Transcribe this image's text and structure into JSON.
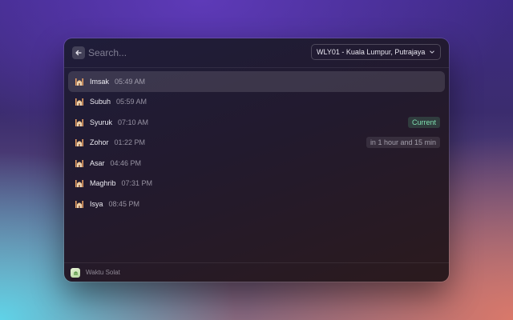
{
  "search": {
    "placeholder": "Search...",
    "value": ""
  },
  "zone_dropdown": {
    "selected": "WLY01 - Kuala Lumpur, Putrajaya"
  },
  "prayers": [
    {
      "name": "Imsak",
      "time": "05:49 AM",
      "accessory": "",
      "selected": true
    },
    {
      "name": "Subuh",
      "time": "05:59 AM",
      "accessory": "",
      "selected": false
    },
    {
      "name": "Syuruk",
      "time": "07:10 AM",
      "accessory": "Current",
      "accessory_type": "current",
      "selected": false
    },
    {
      "name": "Zohor",
      "time": "01:22 PM",
      "accessory": "in 1 hour and 15 min",
      "accessory_type": "countdown",
      "selected": false
    },
    {
      "name": "Asar",
      "time": "04:46 PM",
      "accessory": "",
      "selected": false
    },
    {
      "name": "Maghrib",
      "time": "07:31 PM",
      "accessory": "",
      "selected": false
    },
    {
      "name": "Isya",
      "time": "08:45 PM",
      "accessory": "",
      "selected": false
    }
  ],
  "footer": {
    "app_name": "Waktu Solat"
  },
  "icons": {
    "back": "arrow-left-icon",
    "dropdown": "chevron-down-icon",
    "prayer": "mosque-icon",
    "app": "app-icon"
  },
  "colors": {
    "current_badge_text": "#7fe0b0",
    "selection": "#3a3448"
  }
}
